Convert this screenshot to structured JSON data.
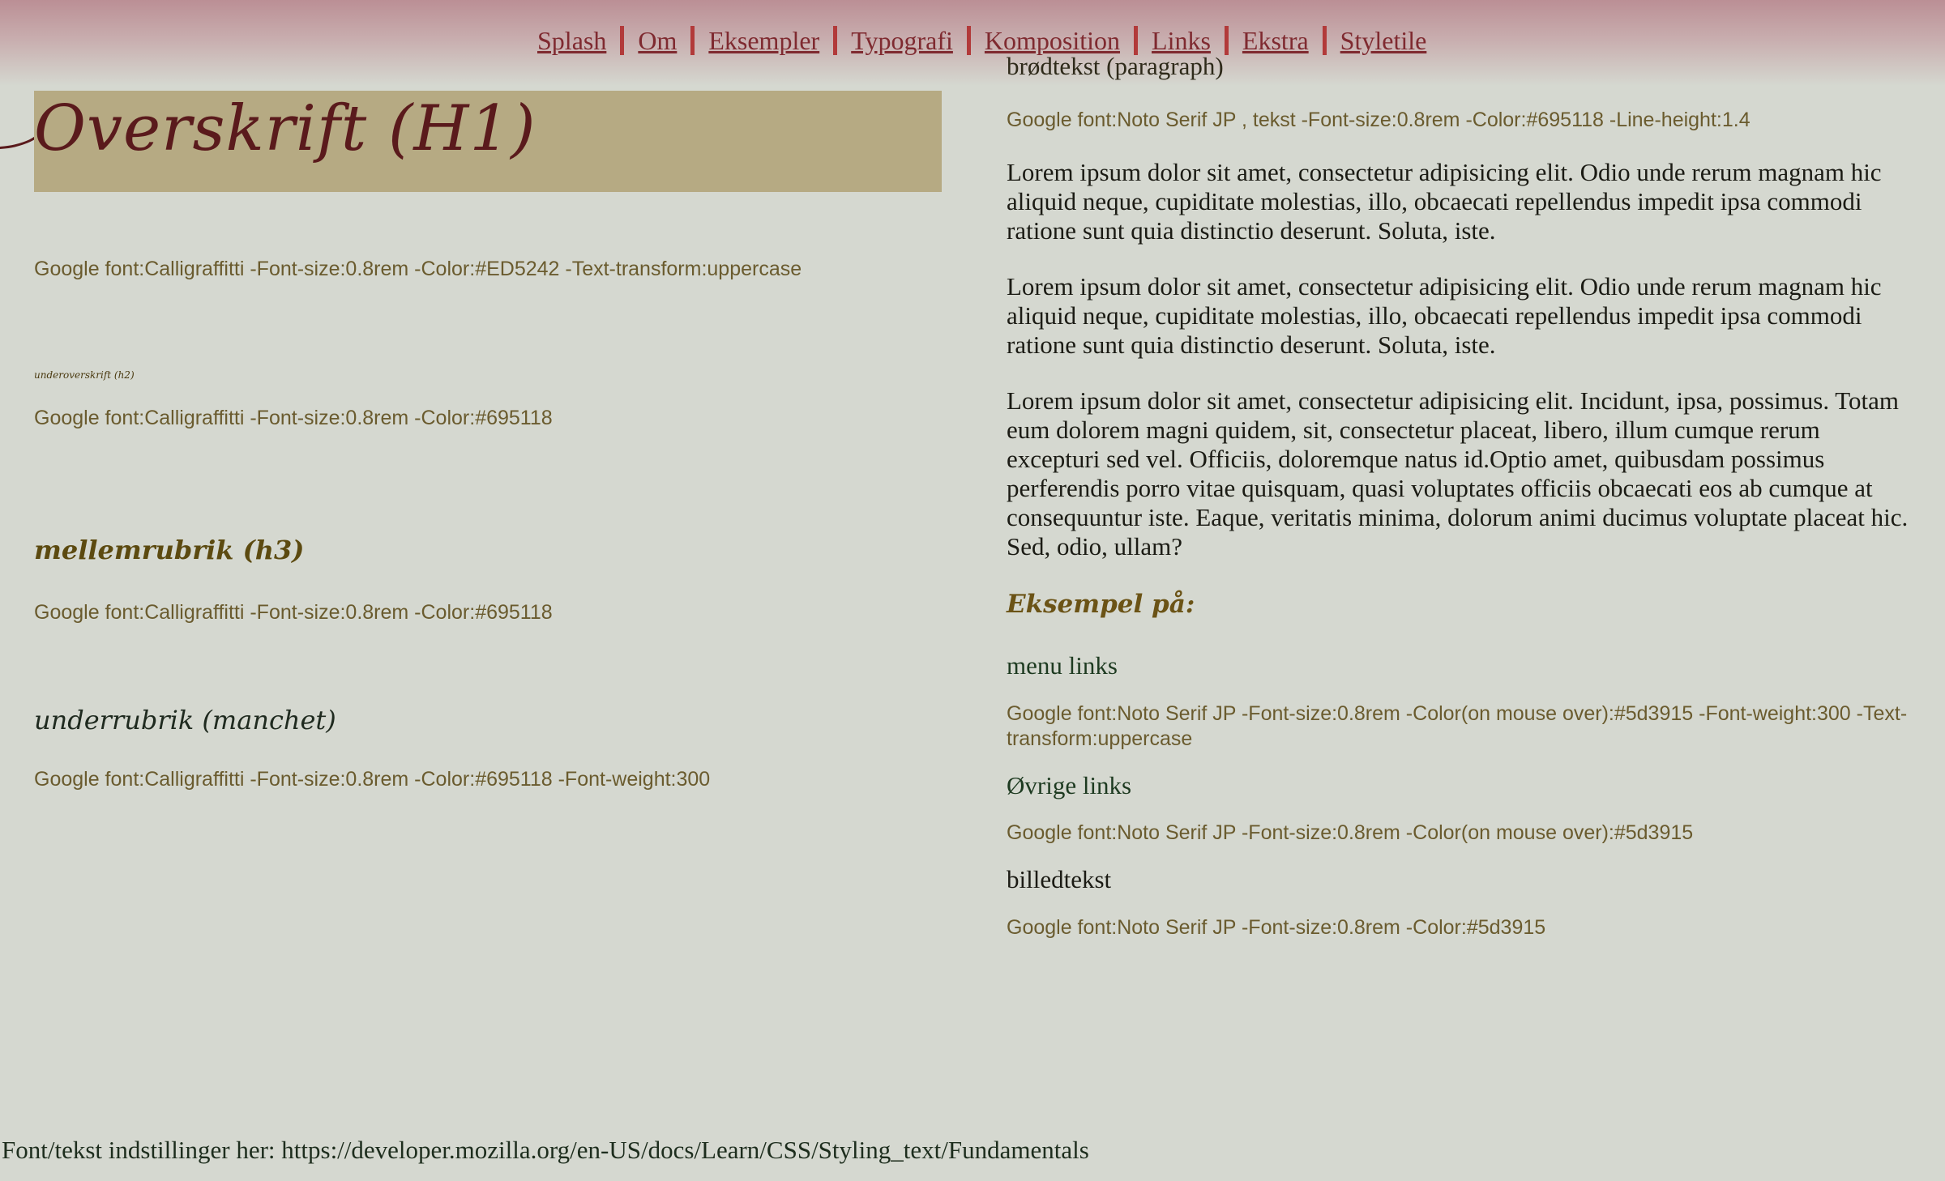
{
  "nav": {
    "items": [
      "Splash",
      "Om",
      "Eksempler",
      "Typografi",
      "Komposition",
      "Links",
      "Ekstra",
      "Styletile"
    ]
  },
  "left": {
    "h1": "Overskrift (H1)",
    "h1_note": "Google font:Calligraffitti -Font-size:0.8rem -Color:#ED5242 -Text-transform:uppercase",
    "h2": "underoverskrift (h2)",
    "h2_note": "Google font:Calligraffitti -Font-size:0.8rem -Color:#695118",
    "h3": "mellemrubrik (h3)",
    "h3_note": "Google font:Calligraffitti -Font-size:0.8rem -Color:#695118",
    "manchet": "underrubrik (manchet)",
    "manchet_note": "Google font:Calligraffitti -Font-size:0.8rem -Color:#695118 -Font-weight:300"
  },
  "right": {
    "title": "brødtekst (paragraph)",
    "title_note": "Google font:Noto Serif JP , tekst -Font-size:0.8rem -Color:#695118 -Line-height:1.4",
    "paragraphs": [
      "Lorem ipsum dolor sit amet, consectetur adipisicing elit. Odio unde rerum magnam hic aliquid neque, cupiditate molestias, illo, obcaecati repellendus impedit ipsa commodi ratione sunt quia distinctio deserunt. Soluta, iste.",
      "Lorem ipsum dolor sit amet, consectetur adipisicing elit. Odio unde rerum magnam hic aliquid neque, cupiditate molestias, illo, obcaecati repellendus impedit ipsa commodi ratione sunt quia distinctio deserunt. Soluta, iste.",
      "Lorem ipsum dolor sit amet, consectetur adipisicing elit. Incidunt, ipsa, possimus. Totam eum dolorem magni quidem, sit, consectetur placeat, libero, illum cumque rerum excepturi sed vel. Officiis, doloremque natus id.Optio amet, quibusdam possimus perferendis porro vitae quisquam, quasi voluptates officiis obcaecati eos ab cumque at consequuntur iste. Eaque, veritatis minima, dolorum animi ducimus voluptate placeat hic. Sed, odio, ullam?"
    ],
    "example_heading": "Eksempel på:",
    "menu_links_label": "menu links",
    "menu_links_note": "Google font:Noto Serif JP -Font-size:0.8rem -Color(on mouse over):#5d3915 -Font-weight:300 -Text-transform:uppercase",
    "other_links_label": "Øvrige links",
    "other_links_note": "Google font:Noto Serif JP -Font-size:0.8rem -Color(on mouse over):#5d3915",
    "caption_label": "billedtekst",
    "caption_note": "Google font:Noto Serif JP -Font-size:0.8rem -Color:#5d3915"
  },
  "footer": {
    "text": "Font/tekst indstillinger her: https://developer.mozilla.org/en-US/docs/Learn/CSS/Styling_text/Fundamentals"
  },
  "colors": {
    "background": "#d5d8d0",
    "header_box": "#b6aa83",
    "nav_link": "#7f2a30",
    "nav_separator": "#b23a3a",
    "note_text": "#6a5b2e"
  }
}
